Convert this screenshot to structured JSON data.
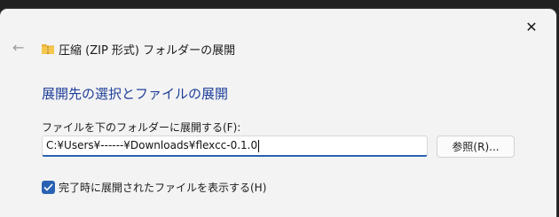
{
  "window": {
    "title": "圧縮 (ZIP 形式) フォルダーの展開",
    "close_glyph": "✕",
    "back_glyph": "←"
  },
  "main": {
    "heading": "展開先の選択とファイルの展開",
    "path_label": "ファイルを下のフォルダーに展開する(F):",
    "path_value": "C:¥Users¥------¥Downloads¥flexcc-0.1.0",
    "browse_label": "参照(R)...",
    "checkbox_label": "完了時に展開されたファイルを表示する(H)",
    "checkbox_checked": true
  },
  "colors": {
    "accent": "#2a62b3",
    "heading": "#1f3f9a",
    "window_bg": "#f3f3f3"
  }
}
